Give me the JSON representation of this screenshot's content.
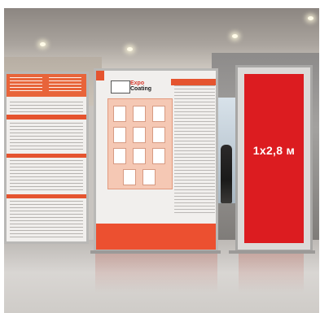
{
  "sign": {
    "size_label": "1x2,8 м",
    "color": "#dc1c20"
  },
  "brand_colors": {
    "accent": "#e5542f"
  }
}
